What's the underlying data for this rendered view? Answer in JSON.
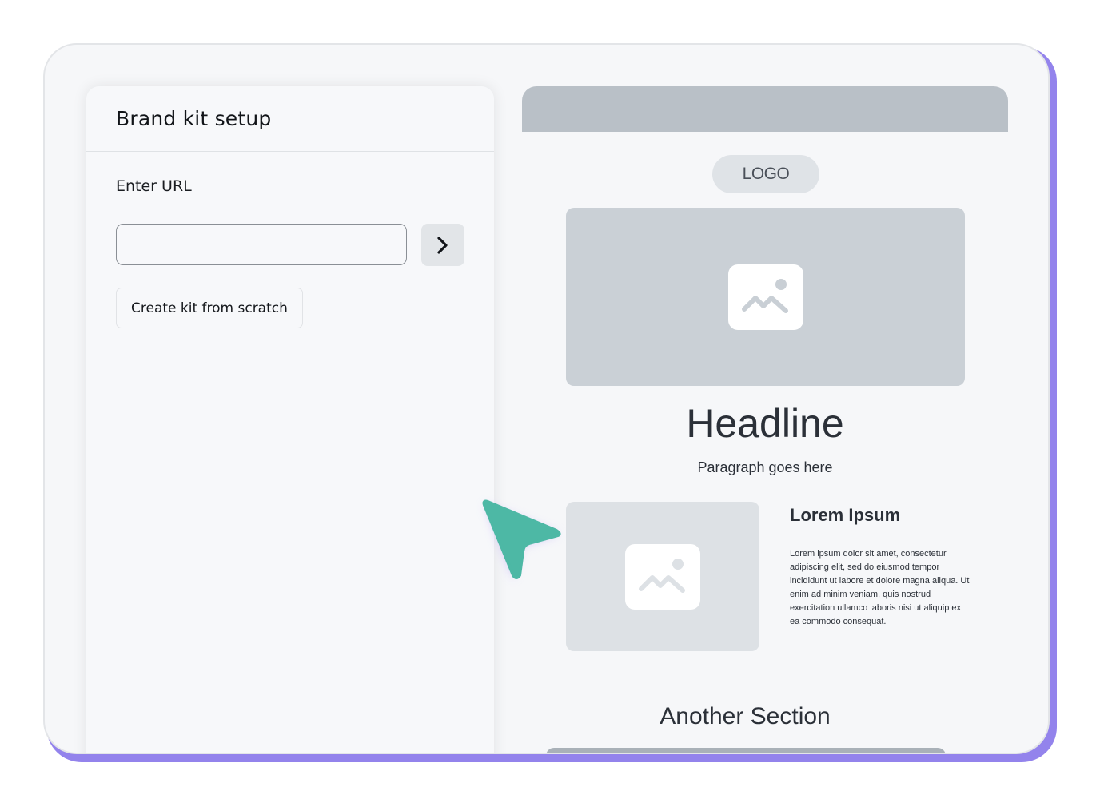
{
  "panel": {
    "title": "Brand kit setup",
    "url_label": "Enter URL",
    "url_value": "",
    "url_placeholder": "",
    "go_icon": "chevron-right-icon",
    "scratch_label": "Create kit from scratch"
  },
  "preview": {
    "logo": "LOGO",
    "hero_image_icon": "image-icon",
    "headline": "Headline",
    "paragraph": "Paragraph goes here",
    "card": {
      "image_icon": "image-icon",
      "title": "Lorem Ipsum",
      "text": "Lorem ipsum dolor sit amet, consectetur adipiscing elit, sed do eiusmod tempor incididunt ut labore et dolore magna aliqua. Ut enim ad minim veniam, quis nostrud exercitation ullamco laboris nisi ut aliquip ex ea commodo consequat."
    },
    "section_title": "Another Section"
  },
  "colors": {
    "accent_frame": "#9383ec",
    "cursor": "#4db8a5",
    "preview_bar": "#b9c0c7"
  }
}
